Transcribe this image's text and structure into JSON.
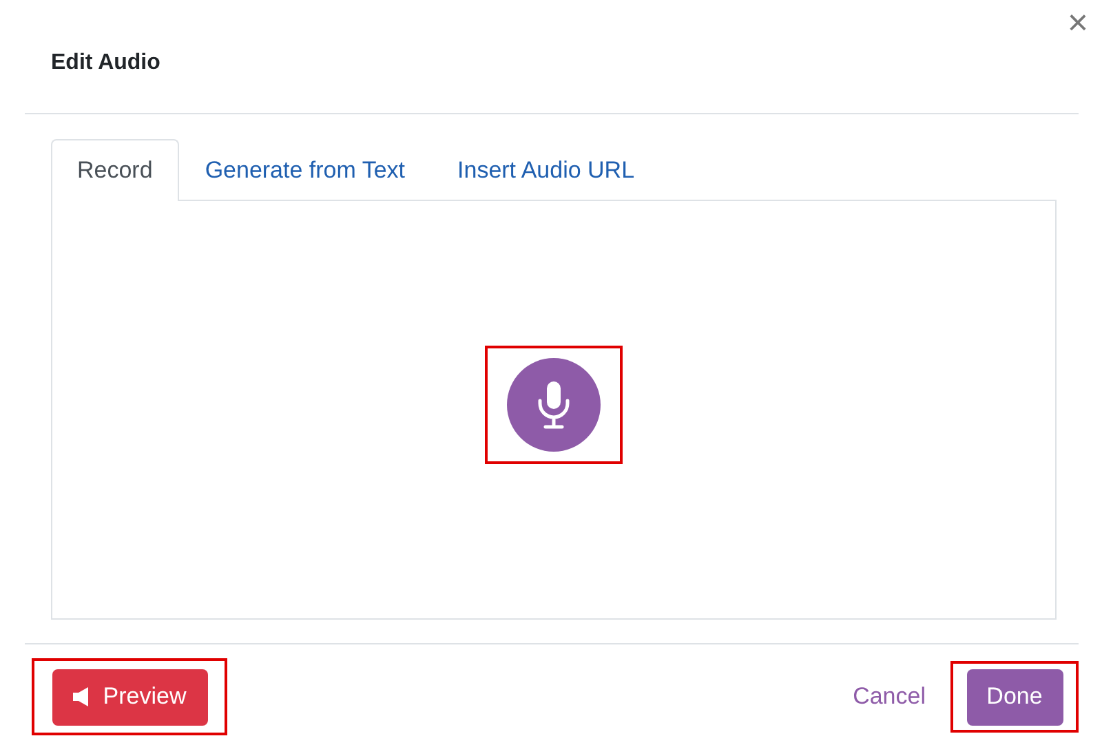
{
  "dialog": {
    "title": "Edit Audio",
    "close": "×"
  },
  "tabs": [
    {
      "label": "Record",
      "selected": true
    },
    {
      "label": "Generate from Text",
      "selected": false
    },
    {
      "label": "Insert Audio URL",
      "selected": false
    }
  ],
  "record_button": {
    "highlighted": true
  },
  "footer": {
    "preview": {
      "label": "Preview",
      "highlighted": true
    },
    "cancel": {
      "label": "Cancel"
    },
    "done": {
      "label": "Done",
      "highlighted": true
    }
  }
}
